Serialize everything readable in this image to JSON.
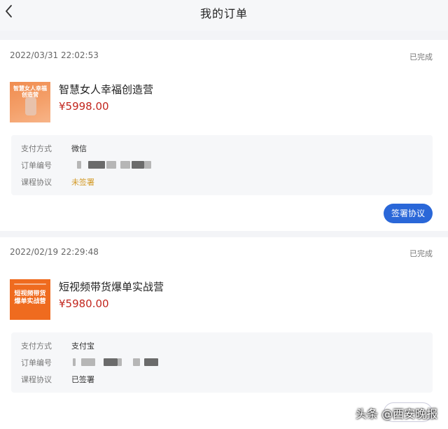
{
  "header": {
    "title": "我的订单",
    "back_icon": "chevron-left-icon"
  },
  "orders": [
    {
      "date": "2022/03/31 22:02:53",
      "status": "已完成",
      "thumbnail_text": "智慧女人幸福创造营",
      "title": "智慧女人幸福创造营",
      "price": "¥5998.00",
      "payment_label": "支付方式",
      "payment_value": "微信",
      "order_no_label": "订单编号",
      "agreement_label": "课程协议",
      "agreement_value": "未签署",
      "button": "签署协议"
    },
    {
      "date": "2022/02/19 22:29:48",
      "status": "已完成",
      "thumbnail_text": "短视频带货爆单实战营",
      "title": "短视频带货爆单实战营",
      "price": "¥5980.00",
      "payment_label": "支付方式",
      "payment_value": "支付宝",
      "order_no_label": "订单编号",
      "agreement_label": "课程协议",
      "agreement_value": "已签署"
    }
  ],
  "watermark": "头条 @西安晚报",
  "colors": {
    "accent": "#2a67d8",
    "price": "#c2261e",
    "pending": "#d39a27"
  }
}
